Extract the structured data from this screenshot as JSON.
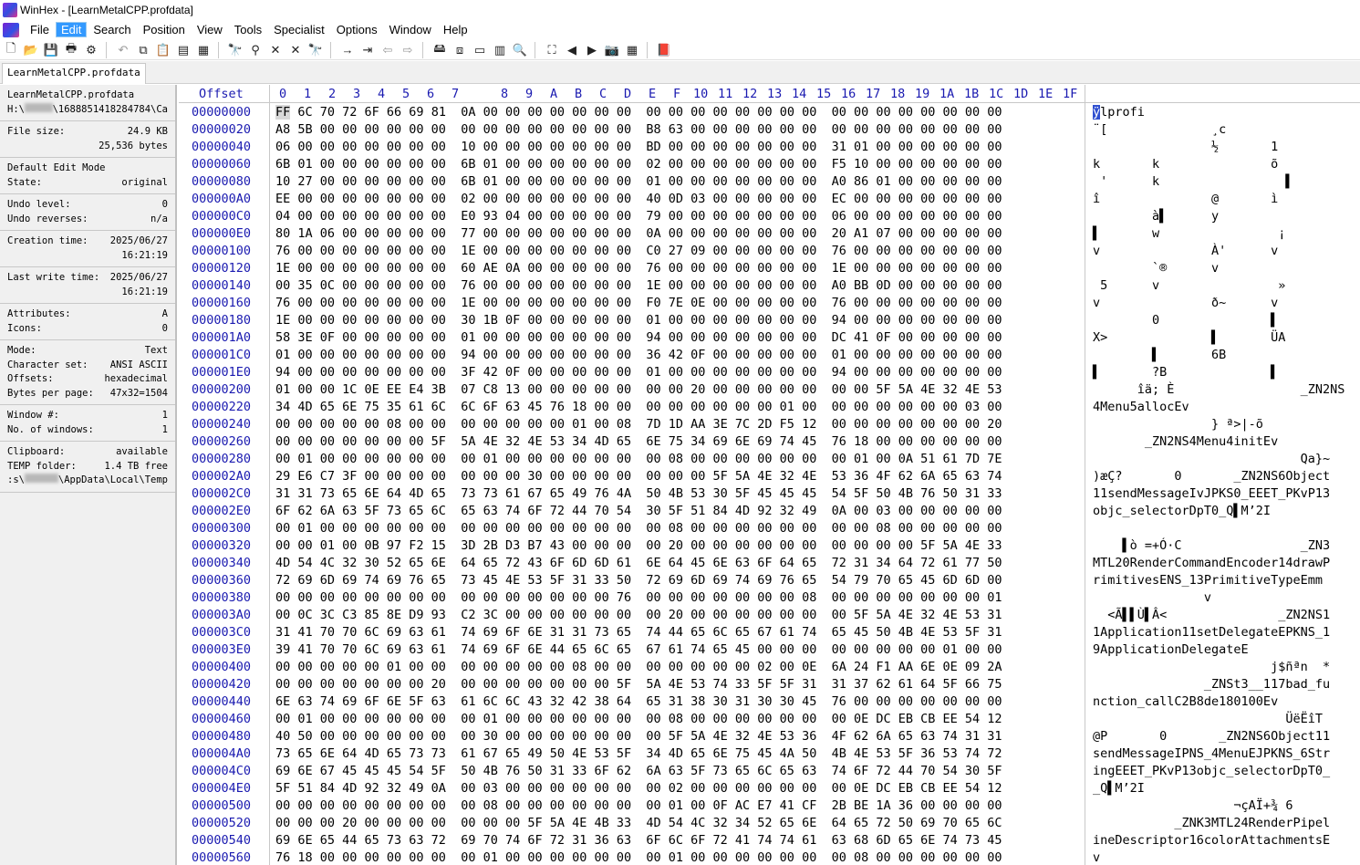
{
  "window": {
    "title": "WinHex - [LearnMetalCPP.profdata]"
  },
  "menubar": {
    "items": [
      "File",
      "Edit",
      "Search",
      "Position",
      "View",
      "Tools",
      "Specialist",
      "Options",
      "Window",
      "Help"
    ],
    "active": "Edit"
  },
  "toolbar": {
    "buttons": [
      "new-file-icon",
      "open-folder-icon",
      "save-icon",
      "print-icon",
      "properties-icon",
      "sep",
      "undo-icon",
      "copy-icon",
      "paste-icon",
      "copy-block-icon",
      "copy-hex-icon",
      "sep",
      "find-icon",
      "find-hex-icon",
      "replace-icon",
      "replace-hex-icon",
      "find-next-icon",
      "sep",
      "goto-offset-icon",
      "goto-sector-icon",
      "back-icon",
      "forward-icon",
      "sep",
      "open-disk-icon",
      "clone-disk-icon",
      "ram-icon",
      "hash-icon",
      "analyze-icon",
      "sep",
      "case-icon",
      "prev-icon",
      "next-icon",
      "camera-icon",
      "calculator-icon",
      "sep",
      "help-book-icon"
    ]
  },
  "tab": {
    "label": "LearnMetalCPP.profdata"
  },
  "info": {
    "filename": "LearnMetalCPP.profdata",
    "path_prefix": "H:\\",
    "path_suffix": "\\1688851418284784\\Ca",
    "file_size_label": "File size:",
    "file_size_kb": "24.9 KB",
    "file_size_bytes": "25,536 bytes",
    "edit_mode_label": "Default Edit Mode",
    "state_label": "State:",
    "state_value": "original",
    "undo_level_label": "Undo level:",
    "undo_level_value": "0",
    "undo_reverses_label": "Undo reverses:",
    "undo_reverses_value": "n/a",
    "creation_label": "Creation time:",
    "creation_date": "2025/06/27",
    "creation_time": "16:21:19",
    "lastwrite_label": "Last write time:",
    "lastwrite_date": "2025/06/27",
    "lastwrite_time": "16:21:19",
    "attributes_label": "Attributes:",
    "attributes_value": "A",
    "icons_label": "Icons:",
    "icons_value": "0",
    "mode_label": "Mode:",
    "mode_value": "Text",
    "charset_label": "Character set:",
    "charset_value": "ANSI ASCII",
    "offsets_label": "Offsets:",
    "offsets_value": "hexadecimal",
    "bpp_label": "Bytes per page:",
    "bpp_value": "47x32=1504",
    "window_label": "Window #:",
    "window_value": "1",
    "nwindows_label": "No. of windows:",
    "nwindows_value": "1",
    "clipboard_label": "Clipboard:",
    "clipboard_value": "available",
    "temp_label": "TEMP folder:",
    "temp_value": "1.4 TB free",
    "temp_path_prefix": ":s\\",
    "temp_path_suffix": "\\AppData\\Local\\Temp"
  },
  "hex": {
    "offset_header": "Offset",
    "column_headers": [
      "0",
      "1",
      "2",
      "3",
      "4",
      "5",
      "6",
      "7",
      "8",
      "9",
      "A",
      "B",
      "C",
      "D",
      "E",
      "F",
      "10",
      "11",
      "12",
      "13",
      "14",
      "15",
      "16",
      "17",
      "18",
      "19",
      "1A",
      "1B",
      "1C",
      "1D",
      "1E",
      "1F"
    ],
    "rows": [
      {
        "offset": "00000000",
        "hex": "FF 6C 70 72 6F 66 69 81  0A 00 00 00 00 00 00 00  00 00 00 00 00 00 00 00  00 00 00 00 00 00 00 00",
        "text": "ÿlprofi"
      },
      {
        "offset": "00000020",
        "hex": "A8 5B 00 00 00 00 00 00  00 00 00 00 00 00 00 00  B8 63 00 00 00 00 00 00  00 00 00 00 00 00 00 00",
        "text": "¨[              ¸c"
      },
      {
        "offset": "00000040",
        "hex": "06 00 00 00 00 00 00 00  10 00 00 00 00 00 00 00  BD 00 00 00 00 00 00 00  31 01 00 00 00 00 00 00",
        "text": "                ½       1"
      },
      {
        "offset": "00000060",
        "hex": "6B 01 00 00 00 00 00 00  6B 01 00 00 00 00 00 00  02 00 00 00 00 00 00 00  F5 10 00 00 00 00 00 00",
        "text": "k       k               õ"
      },
      {
        "offset": "00000080",
        "hex": "10 27 00 00 00 00 00 00  6B 01 00 00 00 00 00 00  01 00 00 00 00 00 00 00  A0 86 01 00 00 00 00 00",
        "text": " '      k                 ▌"
      },
      {
        "offset": "000000A0",
        "hex": "EE 00 00 00 00 00 00 00  02 00 00 00 00 00 00 00  40 0D 03 00 00 00 00 00  EC 00 00 00 00 00 00 00",
        "text": "î               @       ì"
      },
      {
        "offset": "000000C0",
        "hex": "04 00 00 00 00 00 00 00  E0 93 04 00 00 00 00 00  79 00 00 00 00 00 00 00  06 00 00 00 00 00 00 00",
        "text": "        à▌      y"
      },
      {
        "offset": "000000E0",
        "hex": "80 1A 06 00 00 00 00 00  77 00 00 00 00 00 00 00  0A 00 00 00 00 00 00 00  20 A1 07 00 00 00 00 00",
        "text": "▌       w                ¡"
      },
      {
        "offset": "00000100",
        "hex": "76 00 00 00 00 00 00 00  1E 00 00 00 00 00 00 00  C0 27 09 00 00 00 00 00  76 00 00 00 00 00 00 00",
        "text": "v               À'      v"
      },
      {
        "offset": "00000120",
        "hex": "1E 00 00 00 00 00 00 00  60 AE 0A 00 00 00 00 00  76 00 00 00 00 00 00 00  1E 00 00 00 00 00 00 00",
        "text": "        `®      v"
      },
      {
        "offset": "00000140",
        "hex": "00 35 0C 00 00 00 00 00  76 00 00 00 00 00 00 00  1E 00 00 00 00 00 00 00  A0 BB 0D 00 00 00 00 00",
        "text": " 5      v                »"
      },
      {
        "offset": "00000160",
        "hex": "76 00 00 00 00 00 00 00  1E 00 00 00 00 00 00 00  F0 7E 0E 00 00 00 00 00  76 00 00 00 00 00 00 00",
        "text": "v               ð~      v"
      },
      {
        "offset": "00000180",
        "hex": "1E 00 00 00 00 00 00 00  30 1B 0F 00 00 00 00 00  01 00 00 00 00 00 00 00  94 00 00 00 00 00 00 00",
        "text": "        0               ▌"
      },
      {
        "offset": "000001A0",
        "hex": "58 3E 0F 00 00 00 00 00  01 00 00 00 00 00 00 00  94 00 00 00 00 00 00 00  DC 41 0F 00 00 00 00 00",
        "text": "X>              ▌       ÜA"
      },
      {
        "offset": "000001C0",
        "hex": "01 00 00 00 00 00 00 00  94 00 00 00 00 00 00 00  36 42 0F 00 00 00 00 00  01 00 00 00 00 00 00 00",
        "text": "        ▌       6B"
      },
      {
        "offset": "000001E0",
        "hex": "94 00 00 00 00 00 00 00  3F 42 0F 00 00 00 00 00  01 00 00 00 00 00 00 00  94 00 00 00 00 00 00 00",
        "text": "▌       ?B              ▌"
      },
      {
        "offset": "00000200",
        "hex": "01 00 00 1C 0E EE E4 3B  07 C8 13 00 00 00 00 00  00 00 20 00 00 00 00 00  00 00 5F 5A 4E 32 4E 53",
        "text": "      îä; È                 _ZN2NS"
      },
      {
        "offset": "00000220",
        "hex": "34 4D 65 6E 75 35 61 6C  6C 6F 63 45 76 18 00 00  00 00 00 00 00 00 01 00  00 00 00 00 00 00 03 00",
        "text": "4Menu5allocEv"
      },
      {
        "offset": "00000240",
        "hex": "00 00 00 00 00 08 00 00  00 00 00 00 00 01 00 08  7D 1D AA 3E 7C 2D F5 12  00 00 00 00 00 00 00 20",
        "text": "                } ª>|-õ"
      },
      {
        "offset": "00000260",
        "hex": "00 00 00 00 00 00 00 5F  5A 4E 32 4E 53 34 4D 65  6E 75 34 69 6E 69 74 45  76 18 00 00 00 00 00 00",
        "text": "       _ZN2NS4Menu4initEv"
      },
      {
        "offset": "00000280",
        "hex": "00 01 00 00 00 00 00 00  00 01 00 00 00 00 00 00  00 08 00 00 00 00 00 00  00 01 00 0A 51 61 7D 7E",
        "text": "                            Qa}~"
      },
      {
        "offset": "000002A0",
        "hex": "29 E6 C7 3F 00 00 00 00  00 00 00 30 00 00 00 00  00 00 00 5F 5A 4E 32 4E  53 36 4F 62 6A 65 63 74",
        "text": ")æÇ?       0       _ZN2NS6Object"
      },
      {
        "offset": "000002C0",
        "hex": "31 31 73 65 6E 64 4D 65  73 73 61 67 65 49 76 4A  50 4B 53 30 5F 45 45 45  54 5F 50 4B 76 50 31 33",
        "text": "11sendMessageIvJPKS0_EEET_PKvP13"
      },
      {
        "offset": "000002E0",
        "hex": "6F 62 6A 63 5F 73 65 6C  65 63 74 6F 72 44 70 54  30 5F 51 84 4D 92 32 49  0A 00 03 00 00 00 00 00",
        "text": "objc_selectorDpT0_Q▌M’2I"
      },
      {
        "offset": "00000300",
        "hex": "00 01 00 00 00 00 00 00  00 00 00 00 00 00 00 00  00 08 00 00 00 00 00 00  00 00 08 00 00 00 00 00",
        "text": ""
      },
      {
        "offset": "00000320",
        "hex": "00 00 01 00 0B 97 F2 15  3D 2B D3 B7 43 00 00 00  00 20 00 00 00 00 00 00  00 00 00 00 5F 5A 4E 33",
        "text": "    ▌ò =+Ó·C                _ZN3"
      },
      {
        "offset": "00000340",
        "hex": "4D 54 4C 32 30 52 65 6E  64 65 72 43 6F 6D 6D 61  6E 64 45 6E 63 6F 64 65  72 31 34 64 72 61 77 50",
        "text": "MTL20RenderCommandEncoder14drawP"
      },
      {
        "offset": "00000360",
        "hex": "72 69 6D 69 74 69 76 65  73 45 4E 53 5F 31 33 50  72 69 6D 69 74 69 76 65  54 79 70 65 45 6D 6D 00",
        "text": "rimitivesENS_13PrimitiveTypeEmm"
      },
      {
        "offset": "00000380",
        "hex": "00 00 00 00 00 00 00 00  00 00 00 00 00 00 00 76  00 00 00 00 00 00 00 08  00 00 00 00 00 00 00 01",
        "text": "               v"
      },
      {
        "offset": "000003A0",
        "hex": "00 0C 3C C3 85 8E D9 93  C2 3C 00 00 00 00 00 00  00 20 00 00 00 00 00 00  00 5F 5A 4E 32 4E 53 31",
        "text": "  <Ã▌▌Ù▌Â<               _ZN2NS1"
      },
      {
        "offset": "000003C0",
        "hex": "31 41 70 70 6C 69 63 61  74 69 6F 6E 31 31 73 65  74 44 65 6C 65 67 61 74  65 45 50 4B 4E 53 5F 31",
        "text": "1Application11setDelegateEPKNS_1"
      },
      {
        "offset": "000003E0",
        "hex": "39 41 70 70 6C 69 63 61  74 69 6F 6E 44 65 6C 65  67 61 74 65 45 00 00 00  00 00 00 00 00 01 00 00",
        "text": "9ApplicationDelegateE"
      },
      {
        "offset": "00000400",
        "hex": "00 00 00 00 00 01 00 00  00 00 00 00 00 08 00 00  00 00 00 00 00 02 00 0E  6A 24 F1 AA 6E 0E 09 2A",
        "text": "                        j$ñªn  *"
      },
      {
        "offset": "00000420",
        "hex": "00 00 00 00 00 00 00 20  00 00 00 00 00 00 00 5F  5A 4E 53 74 33 5F 5F 31  31 37 62 61 64 5F 66 75",
        "text": "               _ZNSt3__117bad_fu"
      },
      {
        "offset": "00000440",
        "hex": "6E 63 74 69 6F 6E 5F 63  61 6C 6C 43 32 42 38 64  65 31 38 30 31 30 30 45  76 00 00 00 00 00 00 00",
        "text": "nction_callC2B8de180100Ev"
      },
      {
        "offset": "00000460",
        "hex": "00 01 00 00 00 00 00 00  00 01 00 00 00 00 00 00  00 08 00 00 00 00 00 00  00 0E DC EB CB EE 54 12",
        "text": "                          ÜëËîT"
      },
      {
        "offset": "00000480",
        "hex": "40 50 00 00 00 00 00 00  00 30 00 00 00 00 00 00  00 5F 5A 4E 32 4E 53 36  4F 62 6A 65 63 74 31 31",
        "text": "@P       0       _ZN2NS6Object11"
      },
      {
        "offset": "000004A0",
        "hex": "73 65 6E 64 4D 65 73 73  61 67 65 49 50 4E 53 5F  34 4D 65 6E 75 45 4A 50  4B 4E 53 5F 36 53 74 72",
        "text": "sendMessageIPNS_4MenuEJPKNS_6Str"
      },
      {
        "offset": "000004C0",
        "hex": "69 6E 67 45 45 45 54 5F  50 4B 76 50 31 33 6F 62  6A 63 5F 73 65 6C 65 63  74 6F 72 44 70 54 30 5F",
        "text": "ingEEET_PKvP13objc_selectorDpT0_"
      },
      {
        "offset": "000004E0",
        "hex": "5F 51 84 4D 92 32 49 0A  00 03 00 00 00 00 00 00  00 02 00 00 00 00 00 00  00 0E DC EB CB EE 54 12",
        "text": "_Q▌M’2I"
      },
      {
        "offset": "00000500",
        "hex": "00 00 00 00 00 00 00 00  00 08 00 00 00 00 00 00  00 01 00 0F AC E7 41 CF  2B BE 1A 36 00 00 00 00",
        "text": "                   ¬çAÏ+¾ 6"
      },
      {
        "offset": "00000520",
        "hex": "00 00 00 20 00 00 00 00  00 00 00 5F 5A 4E 4B 33  4D 54 4C 32 34 52 65 6E  64 65 72 50 69 70 65 6C",
        "text": "           _ZNK3MTL24RenderPipel"
      },
      {
        "offset": "00000540",
        "hex": "69 6E 65 44 65 73 63 72  69 70 74 6F 72 31 36 63  6F 6C 6F 72 41 74 74 61  63 68 6D 65 6E 74 73 45",
        "text": "ineDescriptor16colorAttachmentsE"
      },
      {
        "offset": "00000560",
        "hex": "76 18 00 00 00 00 00 00  00 01 00 00 00 00 00 00  00 01 00 00 00 00 00 00  00 08 00 00 00 00 00 00",
        "text": "v"
      }
    ]
  }
}
